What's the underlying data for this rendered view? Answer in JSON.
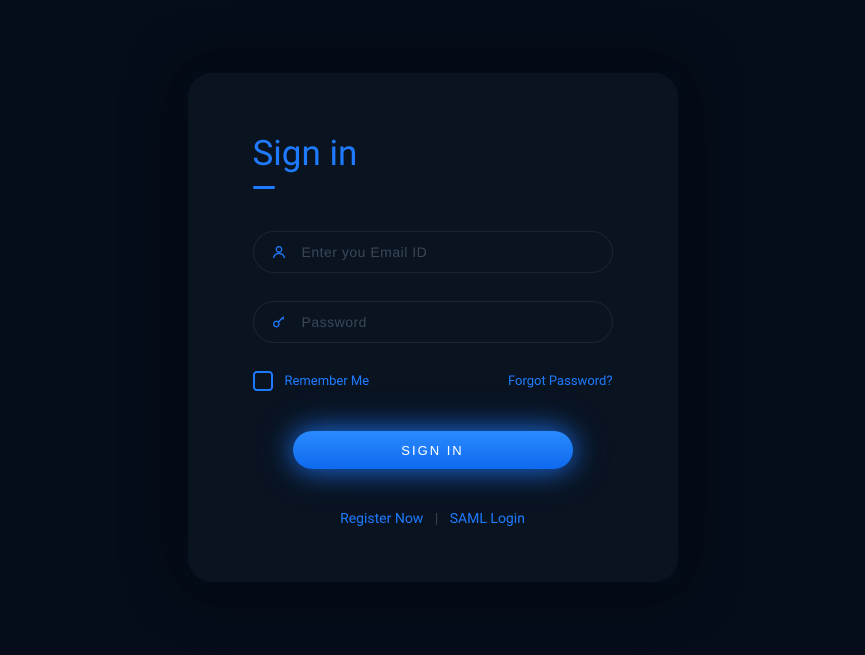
{
  "title": "Sign in",
  "email": {
    "placeholder": "Enter you Email ID",
    "value": ""
  },
  "password": {
    "placeholder": "Password",
    "value": ""
  },
  "rememberMe": {
    "label": "Remember Me",
    "checked": false
  },
  "forgotPassword": "Forgot Password?",
  "signInButton": "SIGN IN",
  "footer": {
    "registerNow": "Register Now",
    "separator": "|",
    "samlLogin": "SAML Login"
  }
}
